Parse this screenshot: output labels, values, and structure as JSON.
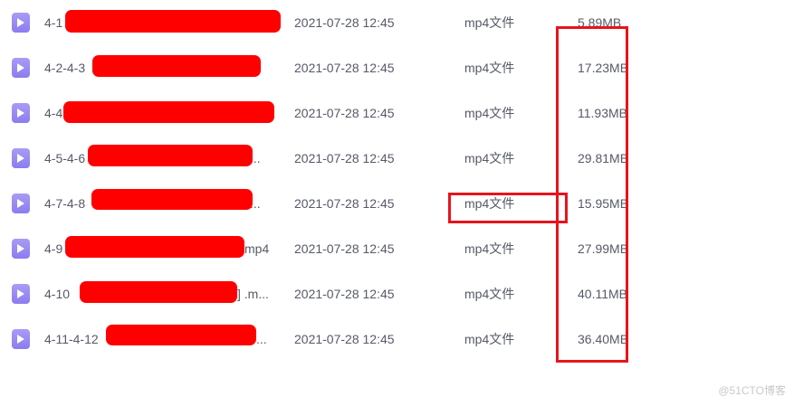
{
  "files": [
    {
      "name": "4-1",
      "name_suffix": "",
      "date": "2021-07-28 12:45",
      "type": "mp4文件",
      "size": "5.89MB"
    },
    {
      "name": "4-2-4-3",
      "name_suffix": "",
      "date": "2021-07-28 12:45",
      "type": "mp4文件",
      "size": "17.23MB"
    },
    {
      "name": "4-4",
      "name_suffix": "",
      "date": "2021-07-28 12:45",
      "type": "mp4文件",
      "size": "11.93MB"
    },
    {
      "name": "4-5-4-6",
      "name_suffix": "...",
      "date": "2021-07-28 12:45",
      "type": "mp4文件",
      "size": "29.81MB"
    },
    {
      "name": "4-7-4-8",
      "name_suffix": "...",
      "date": "2021-07-28 12:45",
      "type": "mp4文件",
      "size": "15.95MB"
    },
    {
      "name": "4-9",
      "name_suffix": "mp4",
      "date": "2021-07-28 12:45",
      "type": "mp4文件",
      "size": "27.99MB"
    },
    {
      "name": "4-10",
      "name_suffix": "] .m...",
      "date": "2021-07-28 12:45",
      "type": "mp4文件",
      "size": "40.11MB"
    },
    {
      "name": "4-11-4-12",
      "name_suffix": "...",
      "date": "2021-07-28 12:45",
      "type": "mp4文件",
      "size": "36.40MB"
    }
  ],
  "icons": {
    "video_file": "video-file-icon"
  },
  "colors": {
    "icon": "#8b7cf0",
    "redaction": "#ff0000",
    "highlight": "#e8141b",
    "text": "#555a66"
  },
  "watermark": "@51CTO博客"
}
